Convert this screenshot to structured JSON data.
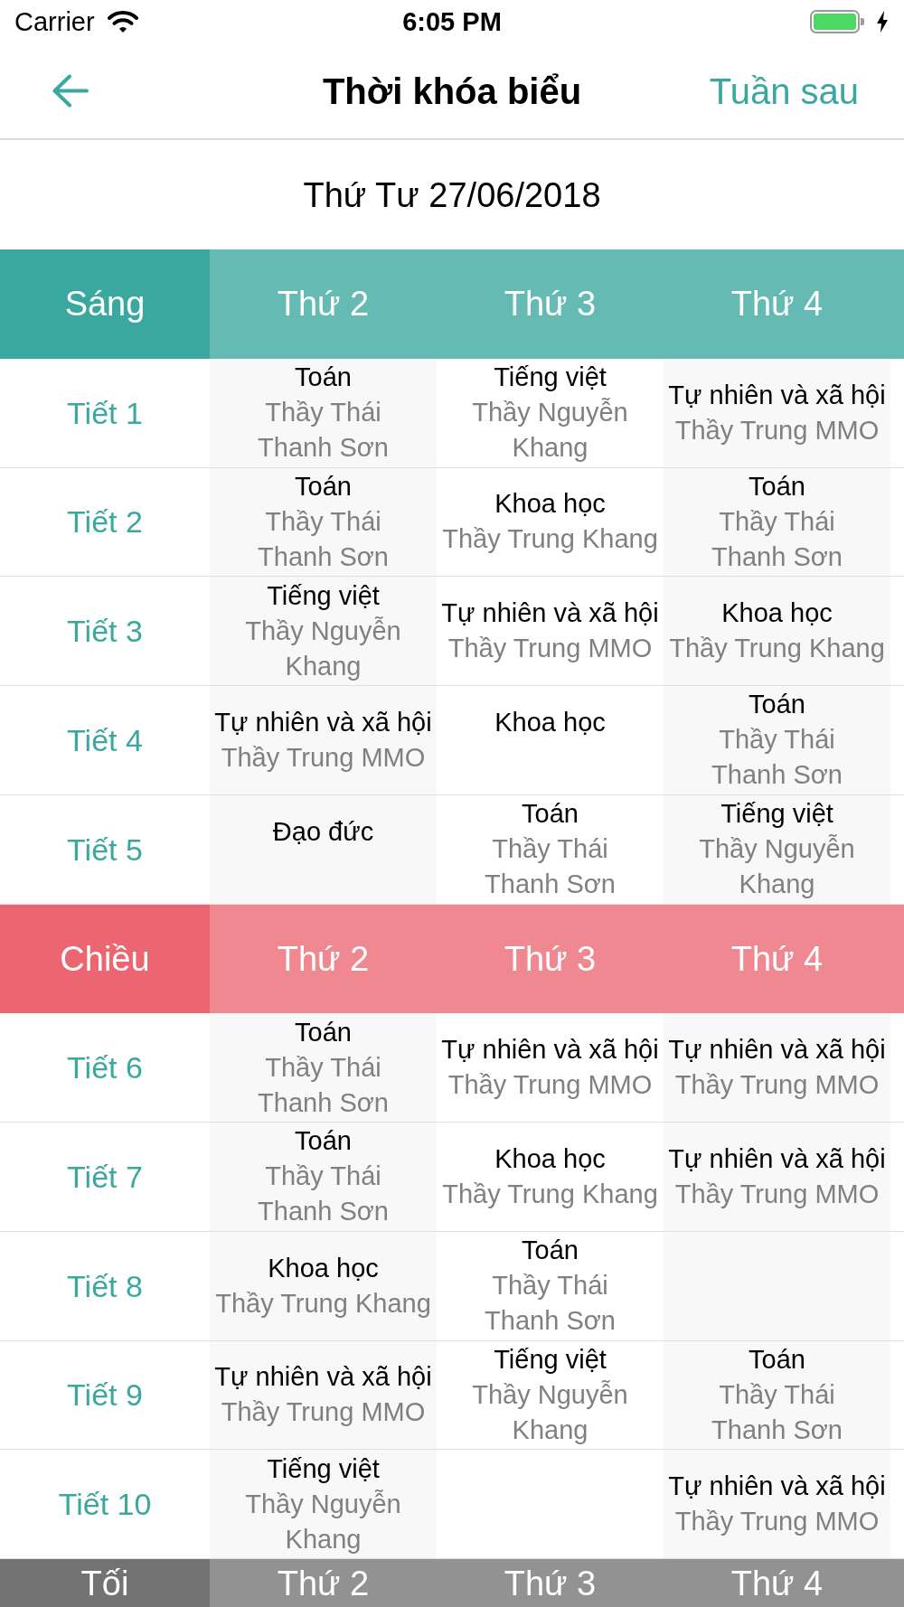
{
  "status_bar": {
    "carrier": "Carrier",
    "time": "6:05 PM"
  },
  "nav_bar": {
    "title": "Thời khóa biểu",
    "right_action": "Tuần sau"
  },
  "date": "Thứ Tư 27/06/2018",
  "sessions": [
    {
      "name": "Sáng",
      "color": "#3aa89f",
      "days": [
        "Thứ 2",
        "Thứ 3",
        "Thứ 4"
      ],
      "periods": [
        {
          "label": "Tiết 1",
          "cells": [
            {
              "subject": "Toán",
              "teacher": "Thầy Thái Thanh Sơn"
            },
            {
              "subject": "Tiếng việt",
              "teacher": "Thầy Nguyễn Khang"
            },
            {
              "subject": "Tự nhiên và xã hội",
              "teacher": "Thầy Trung MMO"
            }
          ]
        },
        {
          "label": "Tiết 2",
          "cells": [
            {
              "subject": "Toán",
              "teacher": "Thầy Thái Thanh Sơn"
            },
            {
              "subject": "Khoa học",
              "teacher": "Thầy Trung Khang"
            },
            {
              "subject": "Toán",
              "teacher": "Thầy Thái Thanh Sơn"
            }
          ]
        },
        {
          "label": "Tiết 3",
          "cells": [
            {
              "subject": "Tiếng việt",
              "teacher": "Thầy Nguyễn Khang"
            },
            {
              "subject": "Tự nhiên và xã hội",
              "teacher": "Thầy Trung MMO"
            },
            {
              "subject": "Khoa học",
              "teacher": "Thầy Trung Khang"
            }
          ]
        },
        {
          "label": "Tiết 4",
          "cells": [
            {
              "subject": "Tự nhiên và xã hội",
              "teacher": "Thầy Trung MMO"
            },
            {
              "subject": "Khoa học"
            },
            {
              "subject": "Toán",
              "teacher": "Thầy Thái Thanh Sơn"
            }
          ]
        },
        {
          "label": "Tiết 5",
          "cells": [
            {
              "subject": "Đạo đức"
            },
            {
              "subject": "Toán",
              "teacher": "Thầy Thái Thanh Sơn"
            },
            {
              "subject": "Tiếng việt",
              "teacher": "Thầy Nguyễn Khang"
            }
          ]
        }
      ]
    },
    {
      "name": "Chiều",
      "color": "#ec6672",
      "days": [
        "Thứ 2",
        "Thứ 3",
        "Thứ 4"
      ],
      "periods": [
        {
          "label": "Tiết 6",
          "cells": [
            {
              "subject": "Toán",
              "teacher": "Thầy Thái Thanh Sơn"
            },
            {
              "subject": "Tự nhiên và xã hội",
              "teacher": "Thầy Trung MMO"
            },
            {
              "subject": "Tự nhiên và xã hội",
              "teacher": "Thầy Trung MMO"
            }
          ]
        },
        {
          "label": "Tiết 7",
          "cells": [
            {
              "subject": "Toán",
              "teacher": "Thầy Thái Thanh Sơn"
            },
            {
              "subject": "Khoa học",
              "teacher": "Thầy Trung Khang"
            },
            {
              "subject": "Tự nhiên và xã hội",
              "teacher": "Thầy Trung MMO"
            }
          ]
        },
        {
          "label": "Tiết 8",
          "cells": [
            {
              "subject": "Khoa học",
              "teacher": "Thầy Trung Khang"
            },
            {
              "subject": "Toán",
              "teacher": "Thầy Thái Thanh Sơn"
            },
            null
          ]
        },
        {
          "label": "Tiết 9",
          "cells": [
            {
              "subject": "Tự nhiên và xã hội",
              "teacher": "Thầy Trung MMO"
            },
            {
              "subject": "Tiếng việt",
              "teacher": "Thầy Nguyễn Khang"
            },
            {
              "subject": "Toán",
              "teacher": "Thầy Thái Thanh Sơn"
            }
          ]
        },
        {
          "label": "Tiết 10",
          "cells": [
            {
              "subject": "Tiếng việt",
              "teacher": "Thầy Nguyễn Khang"
            },
            null,
            {
              "subject": "Tự nhiên và xã hội",
              "teacher": "Thầy Trung MMO"
            }
          ]
        }
      ]
    },
    {
      "name": "Tối",
      "color": "#737373",
      "days": [
        "Thứ 2",
        "Thứ 3",
        "Thứ 4"
      ]
    }
  ]
}
